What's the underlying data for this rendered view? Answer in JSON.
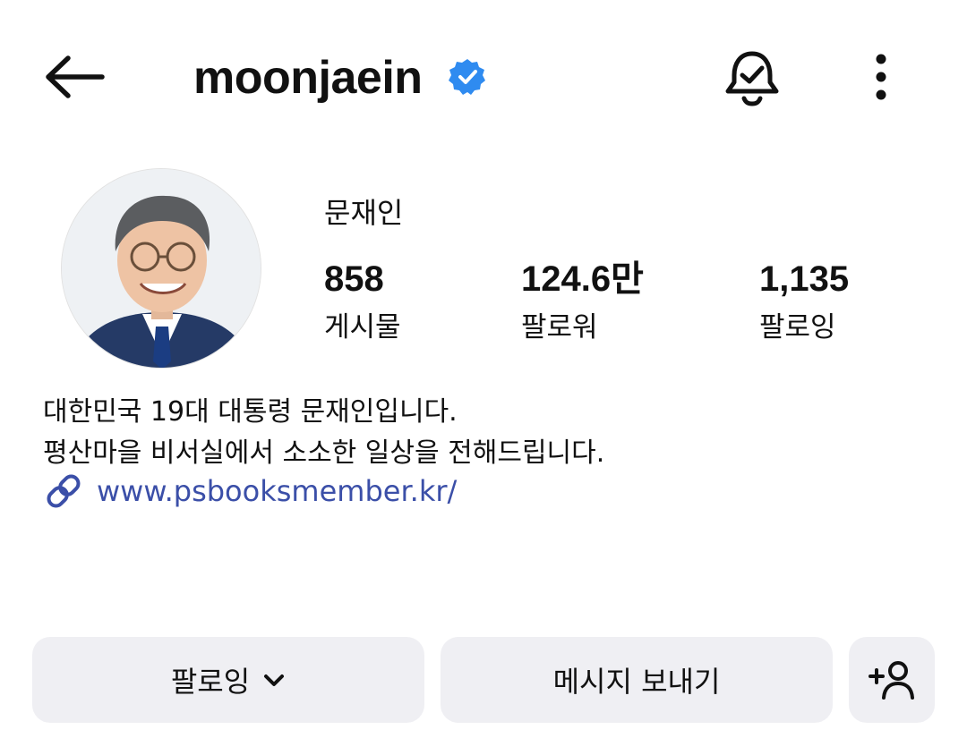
{
  "header": {
    "username": "moonjaein",
    "verified_color": "#2f8bf0"
  },
  "profile": {
    "full_name": "문재인",
    "stats": [
      {
        "number": "858",
        "label": "게시물"
      },
      {
        "number": "124.6만",
        "label": "팔로워"
      },
      {
        "number": "1,135",
        "label": "팔로잉"
      }
    ],
    "bio_lines": [
      "대한민국 19대 대통령 문재인입니다.",
      "평산마을 비서실에서 소소한 일상을 전해드립니다."
    ],
    "link": "www.psbooksmember.kr/",
    "link_color": "#3b4fa8"
  },
  "actions": {
    "following_label": "팔로잉",
    "message_label": "메시지 보내기"
  },
  "icons": [
    "back-arrow-icon",
    "verified-badge-icon",
    "bell-check-icon",
    "more-vertical-icon",
    "link-icon",
    "chevron-down-icon",
    "add-person-icon"
  ]
}
